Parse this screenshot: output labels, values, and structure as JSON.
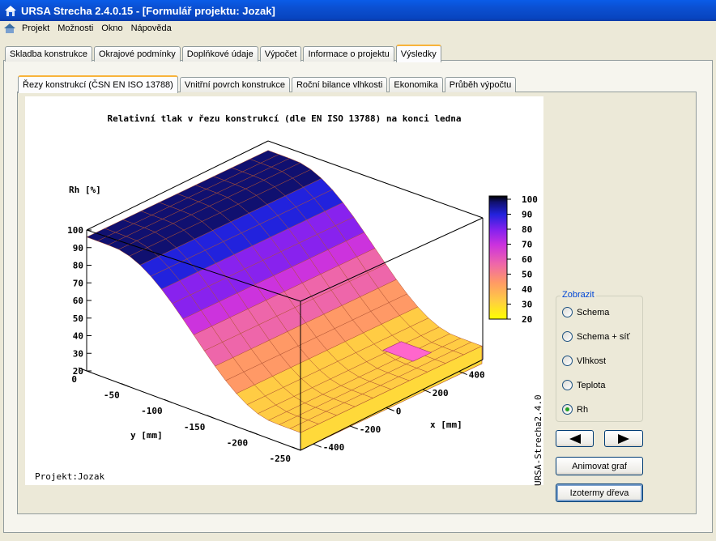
{
  "window": {
    "title": "URSA Strecha 2.4.0.15 - [Formulář projektu: Jozak]",
    "app_icon": "ursa-house-icon"
  },
  "menu": {
    "items": [
      "Projekt",
      "Možnosti",
      "Okno",
      "Nápověda"
    ]
  },
  "main_tabs": [
    "Skladba konstrukce",
    "Okrajové podmínky",
    "Doplňkové údaje",
    "Výpočet",
    "Informace o projektu",
    "Výsledky"
  ],
  "main_tab_active": "Výsledky",
  "sub_tabs": [
    "Řezy konstrukcí (ČSN EN ISO 13788)",
    "Vnitřní povrch konstrukce",
    "Roční bilance vlhkosti",
    "Ekonomika",
    "Průběh výpočtu"
  ],
  "sub_tab_active": "Řezy konstrukcí (ČSN EN ISO 13788)",
  "chart": {
    "title": "Relativní tlak v řezu konstrukcí (dle EN ISO 13788) na konci ledna",
    "z_label": "Rh [%]",
    "x_label": "x [mm]",
    "y_label": "y [mm]",
    "project_label": "Projekt:Jozak",
    "vertical_label": "URSA-Strecha2.4.0"
  },
  "chart_data": {
    "type": "surface",
    "title": "Relativní tlak v řezu konstrukcí (dle EN ISO 13788) na konci ledna",
    "zlabel": "Rh [%]",
    "xlabel": "x [mm]",
    "ylabel": "y [mm]",
    "z_ticks": [
      20,
      30,
      40,
      50,
      60,
      70,
      80,
      90,
      100
    ],
    "x_ticks": [
      -400,
      -200,
      0,
      200,
      400
    ],
    "y_ticks": [
      0,
      -50,
      -100,
      -150,
      -200,
      -250
    ],
    "colorbar_ticks": [
      20,
      30,
      40,
      50,
      60,
      70,
      80,
      90,
      100
    ],
    "zlim": [
      20,
      100
    ],
    "colormap": [
      "#ffff00",
      "#ffcc44",
      "#ff9966",
      "#ee66aa",
      "#cc33dd",
      "#8822ee",
      "#2222dd",
      "#101070",
      "#000000"
    ]
  },
  "display_group": {
    "legend": "Zobrazit",
    "options": [
      "Schema",
      "Schema + síť",
      "Vlhkost",
      "Teplota",
      "Rh"
    ],
    "selected": "Rh"
  },
  "buttons": {
    "prev_icon": "arrow-left-icon",
    "next_icon": "arrow-right-icon",
    "animate": "Animovat graf",
    "isotherms": "Izotermy dřeva"
  }
}
